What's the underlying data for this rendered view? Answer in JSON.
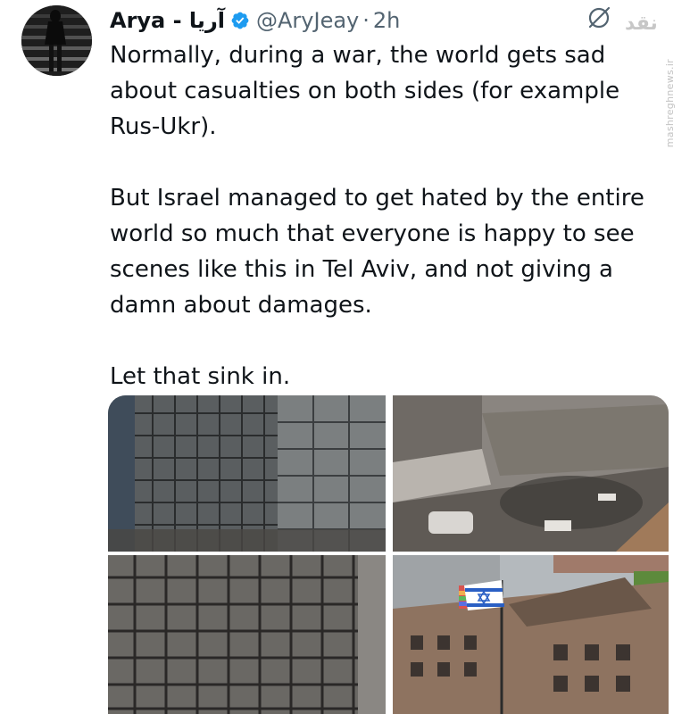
{
  "author": {
    "display_name": "Arya - آریا",
    "handle": "@AryJeay",
    "separator": "·",
    "time": "2h"
  },
  "tweet": {
    "text": "Normally, during a war, the world gets sad\nabout casualties on both sides (for example\nRus-Ukr).\n\nBut Israel managed to get hated by the entire\nworld so much that everyone is happy to see\nscenes like this in Tel Aviv, and not giving a\ndamn about damages.\n\nLet that sink in."
  },
  "watermark": {
    "logo": "نقد",
    "url": "mashreghnews.ir"
  },
  "icons": {
    "verified": "verified-badge-icon",
    "grok": "grok-icon"
  },
  "colors": {
    "text": "#0f1419",
    "secondary": "#536471",
    "verified": "#1d9bf0"
  }
}
